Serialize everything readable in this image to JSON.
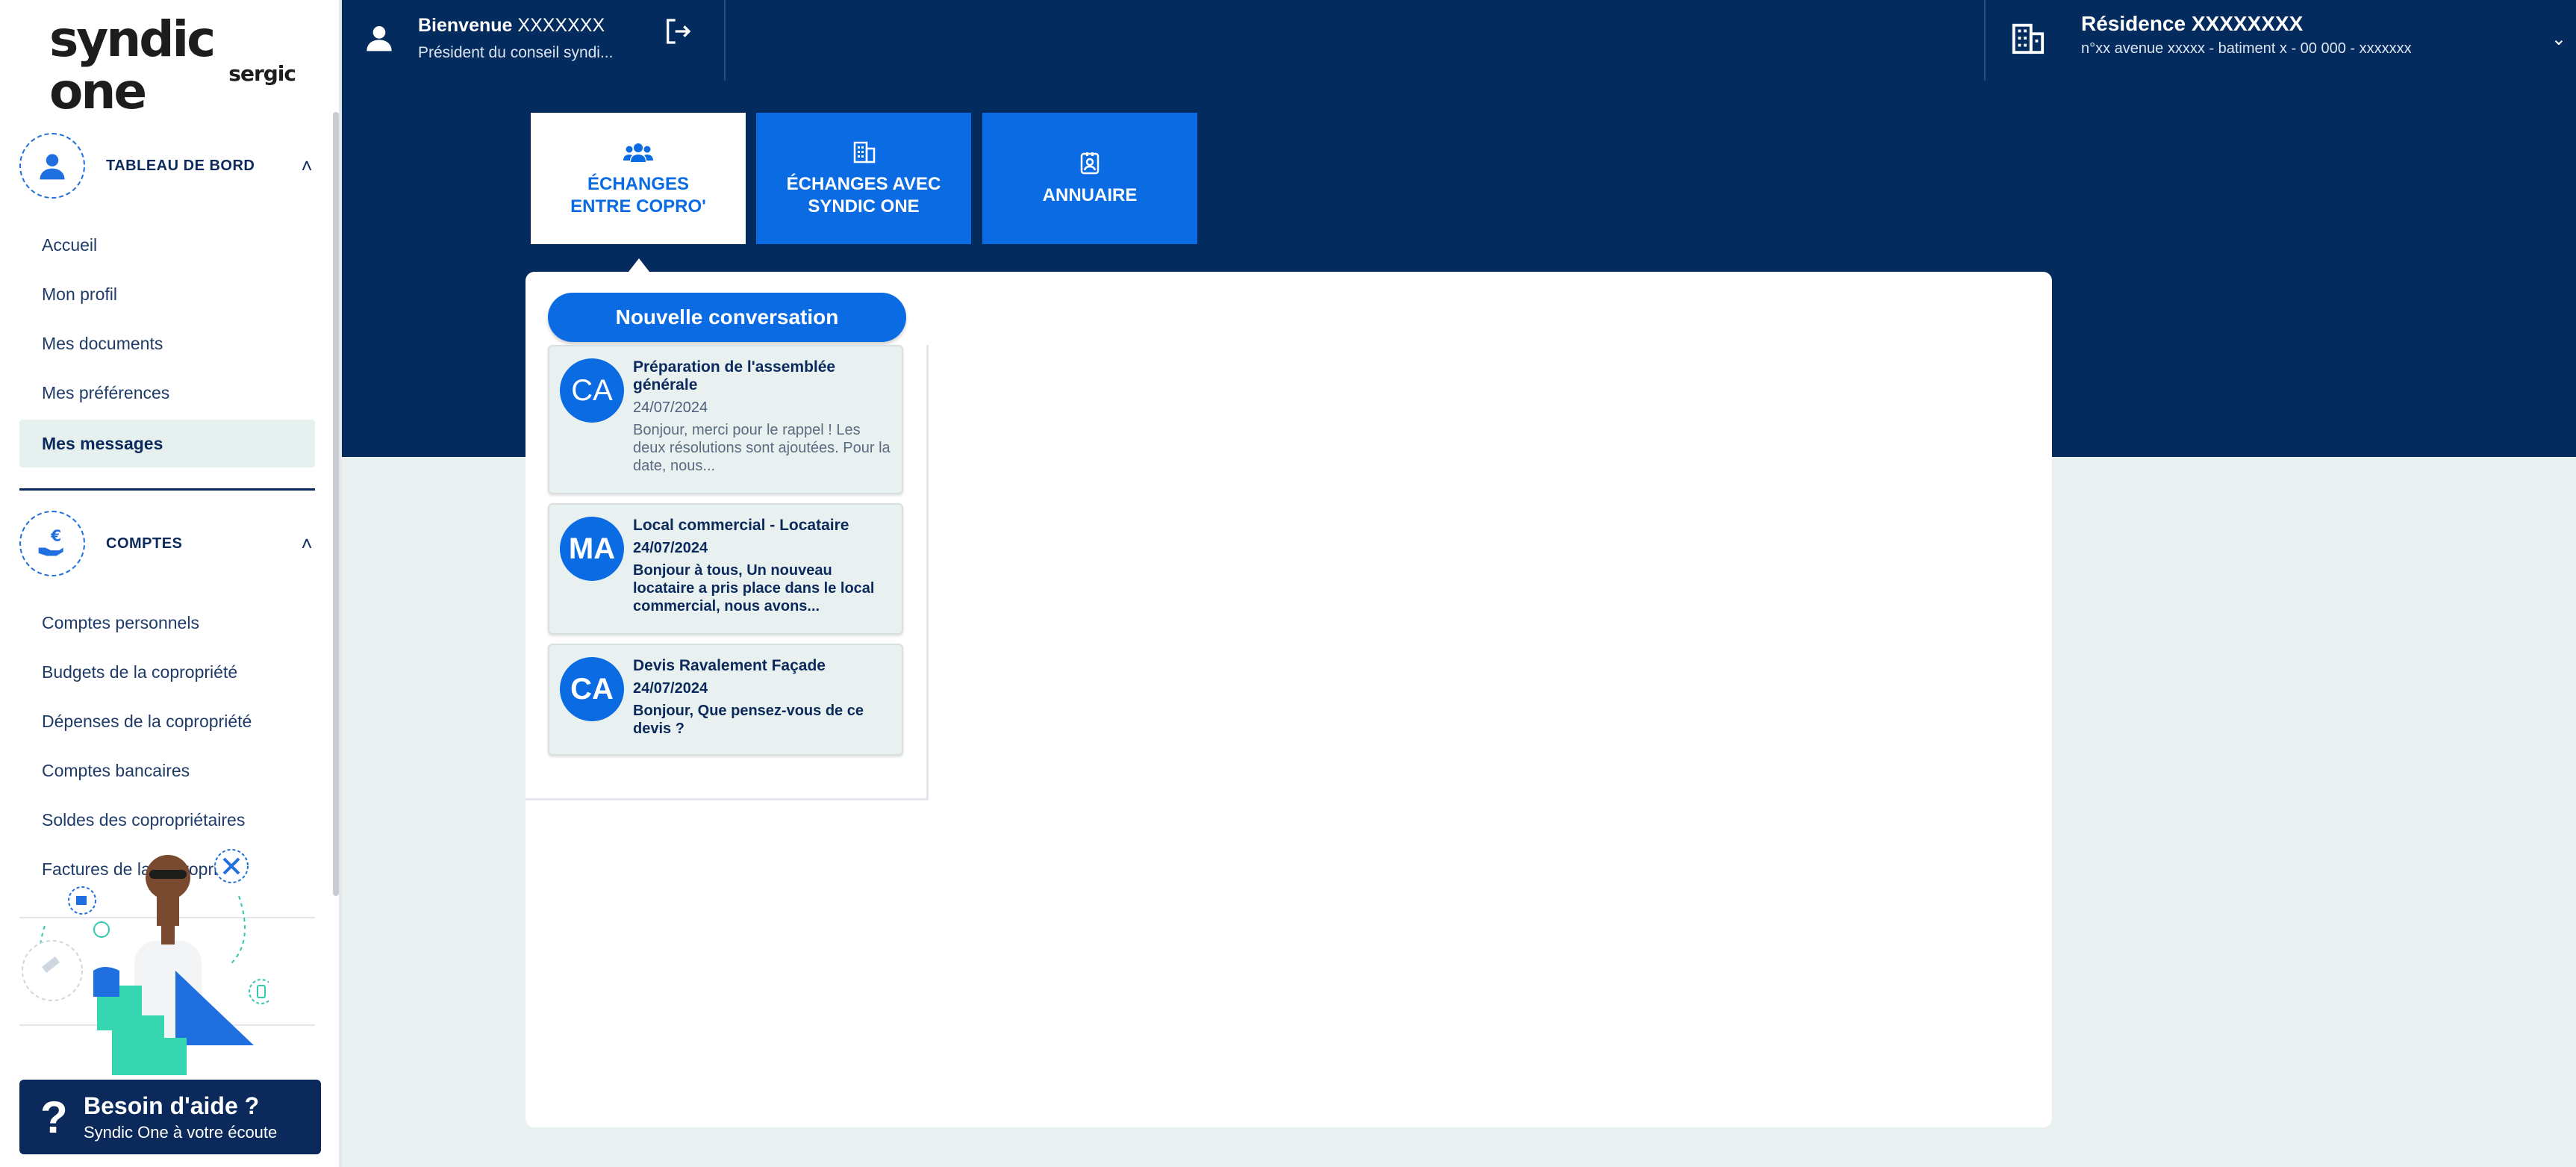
{
  "logo": {
    "main": "syndic one",
    "sub": "sergic"
  },
  "header": {
    "welcome_label": "Bienvenue",
    "user_name": "XXXXXXX",
    "user_role": "Président du conseil syndi...",
    "residence_name": "Résidence XXXXXXXX",
    "residence_address": "n°xx avenue xxxxx - batiment x - 00 000 - xxxxxxx"
  },
  "sidebar": {
    "section1": {
      "title": "TABLEAU DE BORD",
      "items": [
        "Accueil",
        "Mon profil",
        "Mes documents",
        "Mes préférences",
        "Mes messages"
      ]
    },
    "section2": {
      "title": "COMPTES",
      "items": [
        "Comptes personnels",
        "Budgets de la copropriété",
        "Dépenses de la copropriété",
        "Comptes bancaires",
        "Soldes des copropriétaires",
        "Factures de la copropriété"
      ]
    },
    "active_item": "Mes messages"
  },
  "help": {
    "title": "Besoin d'aide ?",
    "subtitle": "Syndic One à votre écoute"
  },
  "tabs": [
    {
      "line1": "ÉCHANGES",
      "line2": "ENTRE COPRO'",
      "icon": "users-icon",
      "active": true
    },
    {
      "line1": "ÉCHANGES AVEC",
      "line2": "SYNDIC ONE",
      "icon": "building-icon",
      "active": false
    },
    {
      "line1": "ANNUAIRE",
      "line2": "",
      "icon": "contact-book-icon",
      "active": false
    }
  ],
  "main": {
    "new_conversation_label": "Nouvelle conversation",
    "conversations": [
      {
        "initials": "CA",
        "title": "Préparation de l'assemblée générale",
        "date": "24/07/2024",
        "preview": "Bonjour, merci pour le rappel ! Les deux résolutions sont ajoutées. Pour la date, nous...",
        "unread": false
      },
      {
        "initials": "MA",
        "title": "Local commercial - Locataire",
        "date": "24/07/2024",
        "preview": "Bonjour à tous, Un nouveau locataire a pris place dans le local commercial, nous avons...",
        "unread": true
      },
      {
        "initials": "CA",
        "title": "Devis Ravalement Façade",
        "date": "24/07/2024",
        "preview": "Bonjour, Que pensez-vous de ce devis ?",
        "unread": true
      }
    ]
  },
  "colors": {
    "navy": "#032b5e",
    "accent_blue": "#0b6be3",
    "light_bg": "#e8f1f0"
  }
}
